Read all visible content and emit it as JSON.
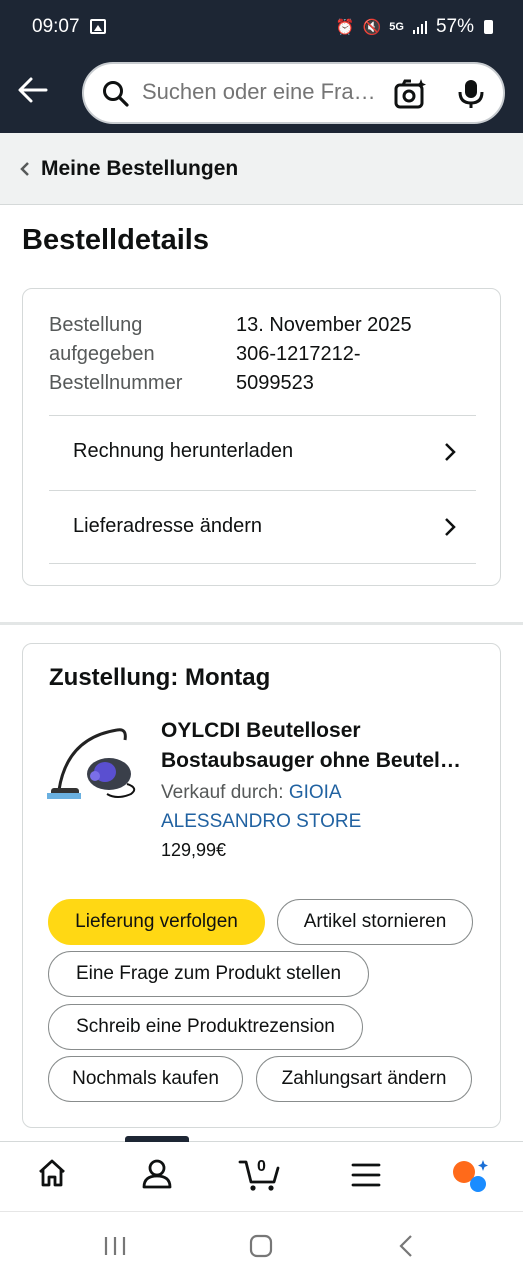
{
  "status_bar": {
    "time": "09:07",
    "network": "5G",
    "battery": "57%"
  },
  "search": {
    "placeholder": "Suchen oder eine Frage stellen"
  },
  "breadcrumb": {
    "label": "Meine Bestellungen"
  },
  "page": {
    "title": "Bestelldetails"
  },
  "order_info": {
    "labels": [
      "Bestellung",
      "aufgegeben",
      "Bestellnummer"
    ],
    "date_value": "13. November 2025",
    "number_line1": "306-1217212-",
    "number_line2": "5099523",
    "download_invoice": "Rechnung herunterladen",
    "change_address": "Lieferadresse ändern"
  },
  "delivery": {
    "title": "Zustellung: Montag",
    "product_title_line1": "OYLCDI Beutelloser",
    "product_title_line2": "Bostaubsauger ohne Beutel…",
    "sold_by_label": "Verkauf durch:",
    "seller_name_part1": "GIOIA",
    "seller_name_part2": "ALESSANDRO STORE",
    "price": "129,99€",
    "buttons": {
      "track": "Lieferung verfolgen",
      "cancel": "Artikel stornieren",
      "ask_question": "Eine Frage zum Produkt stellen",
      "write_review": "Schreib eine Produktrezension",
      "buy_again": "Nochmals kaufen",
      "change_payment": "Zahlungsart ändern"
    }
  },
  "bottom_nav": {
    "cart_count": "0"
  },
  "colors": {
    "header_bg": "#1d2634",
    "primary_button": "#ffd814",
    "link": "#2162a1"
  }
}
